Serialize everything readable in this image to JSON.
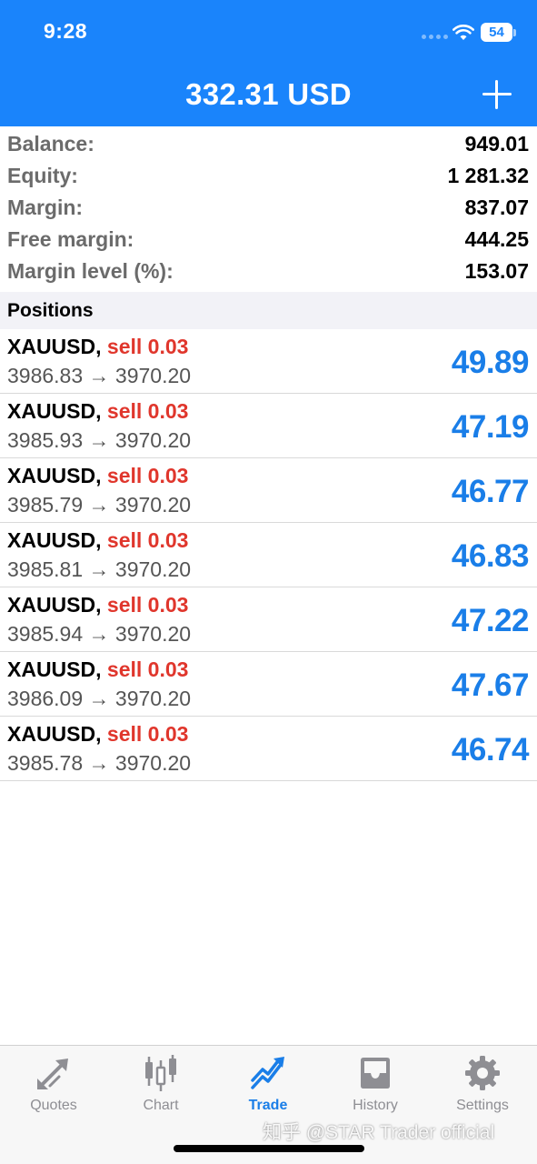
{
  "status": {
    "time": "9:28",
    "battery": "54"
  },
  "header": {
    "title": "332.31 USD",
    "add_icon": "plus-icon"
  },
  "summary": [
    {
      "label": "Balance:",
      "value": "949.01"
    },
    {
      "label": "Equity:",
      "value": "1 281.32"
    },
    {
      "label": "Margin:",
      "value": "837.07"
    },
    {
      "label": "Free margin:",
      "value": "444.25"
    },
    {
      "label": "Margin level (%):",
      "value": "153.07"
    }
  ],
  "positions_section": {
    "title": "Positions"
  },
  "positions": [
    {
      "symbol": "XAUUSD,",
      "side": "sell 0.03",
      "prices": "3986.83 → 3970.20",
      "profit": "49.89"
    },
    {
      "symbol": "XAUUSD,",
      "side": "sell 0.03",
      "prices": "3985.93 → 3970.20",
      "profit": "47.19"
    },
    {
      "symbol": "XAUUSD,",
      "side": "sell 0.03",
      "prices": "3985.79 → 3970.20",
      "profit": "46.77"
    },
    {
      "symbol": "XAUUSD,",
      "side": "sell 0.03",
      "prices": "3985.81 → 3970.20",
      "profit": "46.83"
    },
    {
      "symbol": "XAUUSD,",
      "side": "sell 0.03",
      "prices": "3985.94 → 3970.20",
      "profit": "47.22"
    },
    {
      "symbol": "XAUUSD,",
      "side": "sell 0.03",
      "prices": "3986.09 → 3970.20",
      "profit": "47.67"
    },
    {
      "symbol": "XAUUSD,",
      "side": "sell 0.03",
      "prices": "3985.78 → 3970.20",
      "profit": "46.74"
    }
  ],
  "tabs": [
    {
      "label": "Quotes",
      "icon": "quotes-arrows-icon"
    },
    {
      "label": "Chart",
      "icon": "candlestick-chart-icon"
    },
    {
      "label": "Trade",
      "icon": "trade-trend-icon",
      "active": true
    },
    {
      "label": "History",
      "icon": "inbox-tray-icon"
    },
    {
      "label": "Settings",
      "icon": "gear-icon"
    }
  ],
  "watermark": "知乎 @STAR Trader official",
  "colors": {
    "header": "#1a84fb",
    "profit": "#1a7ee8",
    "sell": "#e0362c",
    "active_tab": "#1a7ee8"
  }
}
